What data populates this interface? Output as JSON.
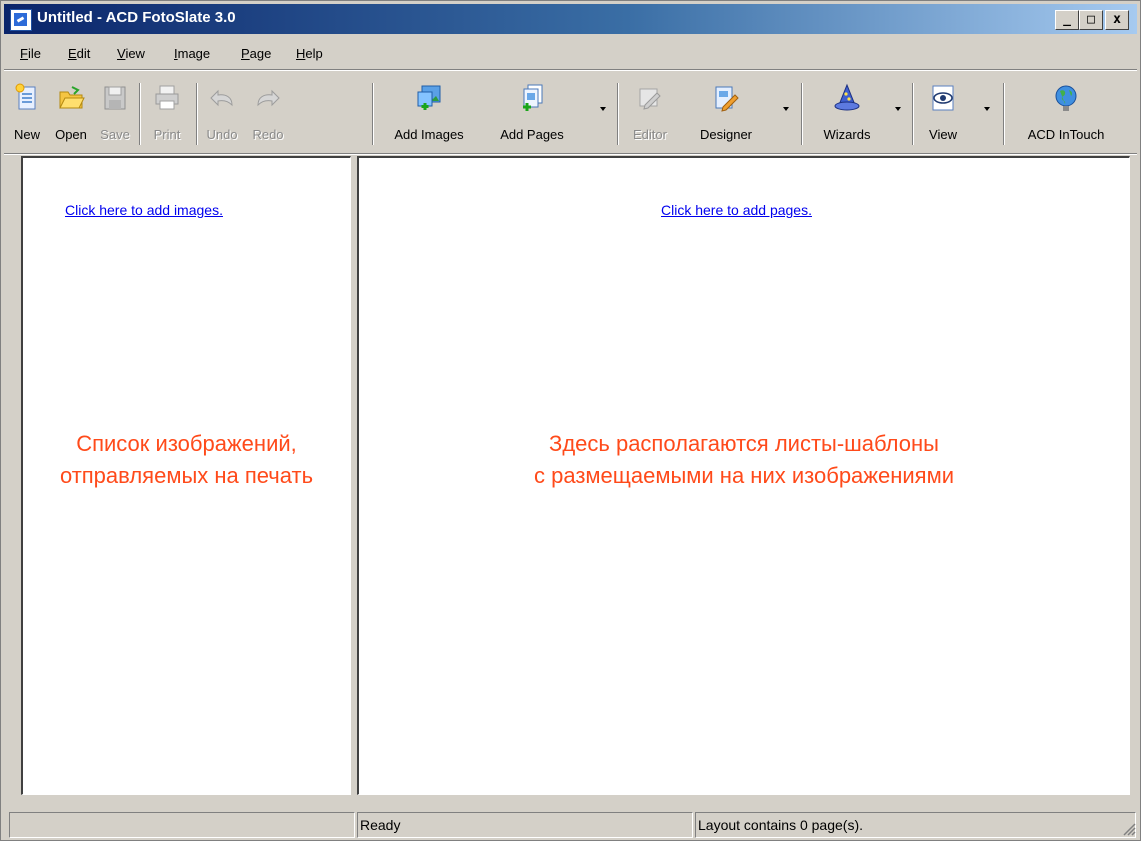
{
  "window": {
    "title": "Untitled - ACD FotoSlate 3.0",
    "controls": {
      "minimize": "_",
      "maximize": "□",
      "close": "x"
    }
  },
  "menu": {
    "items": [
      {
        "id": "file",
        "mn": "F",
        "rest": "ile"
      },
      {
        "id": "edit",
        "mn": "E",
        "rest": "dit"
      },
      {
        "id": "view",
        "mn": "V",
        "rest": "iew"
      },
      {
        "id": "image",
        "mn": "I",
        "rest": "mage"
      },
      {
        "id": "page",
        "mn": "P",
        "rest": "age"
      },
      {
        "id": "help",
        "mn": "H",
        "rest": "elp"
      }
    ]
  },
  "toolbar": {
    "new": "New",
    "open": "Open",
    "save": "Save",
    "print": "Print",
    "undo": "Undo",
    "redo": "Redo",
    "add_images": "Add Images",
    "add_pages": "Add Pages",
    "editor": "Editor",
    "designer": "Designer",
    "wizards": "Wizards",
    "view": "View",
    "acd_intouch": "ACD InTouch"
  },
  "toolbar_icons": {
    "new": "new-document-icon",
    "open": "folder-open-icon",
    "save": "floppy-disk-icon",
    "print": "printer-icon",
    "undo": "undo-arrow-icon",
    "redo": "redo-arrow-icon",
    "add_images": "add-images-icon",
    "add_pages": "add-pages-icon",
    "editor": "editor-icon",
    "designer": "designer-icon",
    "wizards": "wizard-hat-icon",
    "view": "eye-view-icon",
    "acd_intouch": "globe-icon"
  },
  "left_pane": {
    "link": "Click here to add images.",
    "caption_line1": "Список изображений,",
    "caption_line2": "отправляемых на печать"
  },
  "right_pane": {
    "link": "Click here to add pages.",
    "caption_line1": "Здесь располагаются листы-шаблоны",
    "caption_line2": "с размещаемыми на них изображениями"
  },
  "status": {
    "cell1": "",
    "cell2": "Ready",
    "cell3": "Layout contains 0 page(s)."
  },
  "colors": {
    "title_gradient_start": "#0a246a",
    "title_gradient_end": "#a6caf0",
    "link": "#0000ee",
    "caption": "#ff4a1a",
    "chrome": "#d4d0c8"
  }
}
